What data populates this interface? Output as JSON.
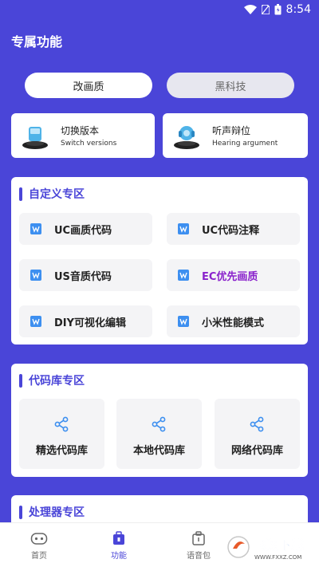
{
  "status_bar": {
    "time": "8:54"
  },
  "header": {
    "title": "专属功能"
  },
  "mode_tabs": [
    {
      "label": "改画质",
      "selected": true
    },
    {
      "label": "黑科技",
      "selected": false
    }
  ],
  "feature_cards": [
    {
      "title": "切换版本",
      "subtitle": "Switch versions",
      "icon": "switch-version-icon"
    },
    {
      "title": "听声辩位",
      "subtitle": "Hearing argument",
      "icon": "hearing-icon"
    }
  ],
  "custom_section": {
    "title": "自定义专区",
    "items": [
      {
        "label": "UC画质代码"
      },
      {
        "label": "UC代码注释"
      },
      {
        "label": "US音质代码"
      },
      {
        "label": "EC优先画质"
      },
      {
        "label": "DIY可视化编辑"
      },
      {
        "label": "小米性能模式"
      }
    ]
  },
  "code_library_section": {
    "title": "代码库专区",
    "items": [
      {
        "label": "精选代码库"
      },
      {
        "label": "本地代码库"
      },
      {
        "label": "网络代码库"
      }
    ]
  },
  "processor_section": {
    "title": "处理器专区"
  },
  "bottom_nav": [
    {
      "label": "首页",
      "active": false
    },
    {
      "label": "功能",
      "active": true
    },
    {
      "label": "语音包",
      "active": false
    }
  ],
  "watermark": {
    "text": "飞翔下载",
    "subtext": "WWW.FXXZ.COM"
  },
  "colors": {
    "primary": "#4a45d8",
    "highlight": "#8a22cc"
  }
}
